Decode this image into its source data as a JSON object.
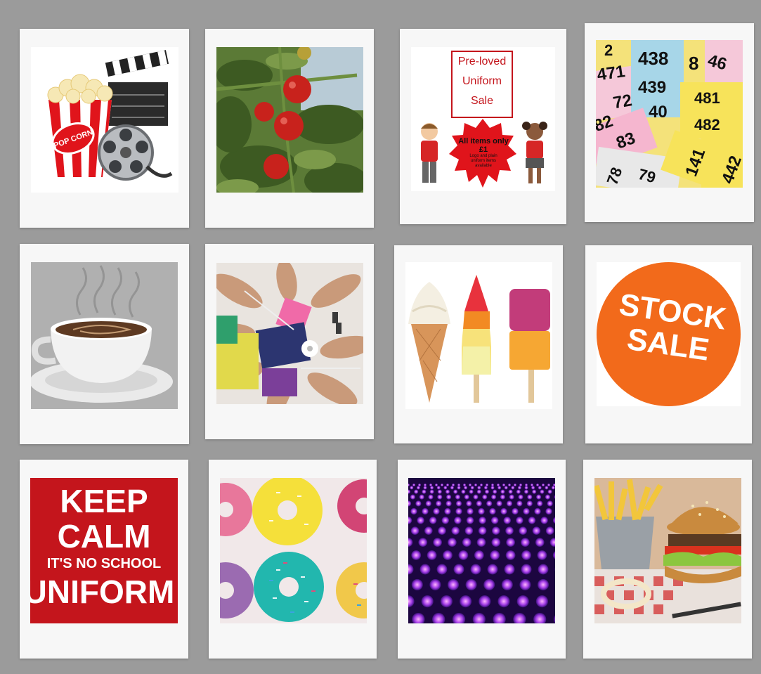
{
  "uniform_sale": {
    "title_line1": "Pre-loved",
    "title_line2": "Uniform",
    "title_line3": "Sale",
    "price_line1": "All items only",
    "price_line2": "£1",
    "note_line1": "Logo and plain",
    "note_line2": "uniform items",
    "note_line3": "available"
  },
  "tickets": [
    "438",
    "439",
    "481",
    "482",
    "471",
    "72",
    "82",
    "83",
    "141",
    "442",
    "46",
    "78",
    "79",
    "40",
    "8",
    "2"
  ],
  "popcorn_label": "POP CORN",
  "stock_sale": {
    "line1": "STOCK",
    "line2": "SALE"
  },
  "keep_calm": {
    "line1": "KEEP",
    "line2": "CALM",
    "line3": "IT'S NO SCHOOL",
    "line4": "UNIFORM"
  },
  "colors": {
    "background": "#9b9b9b",
    "frame": "#f7f7f7",
    "red": "#c4151c",
    "orange": "#f26a1b"
  }
}
